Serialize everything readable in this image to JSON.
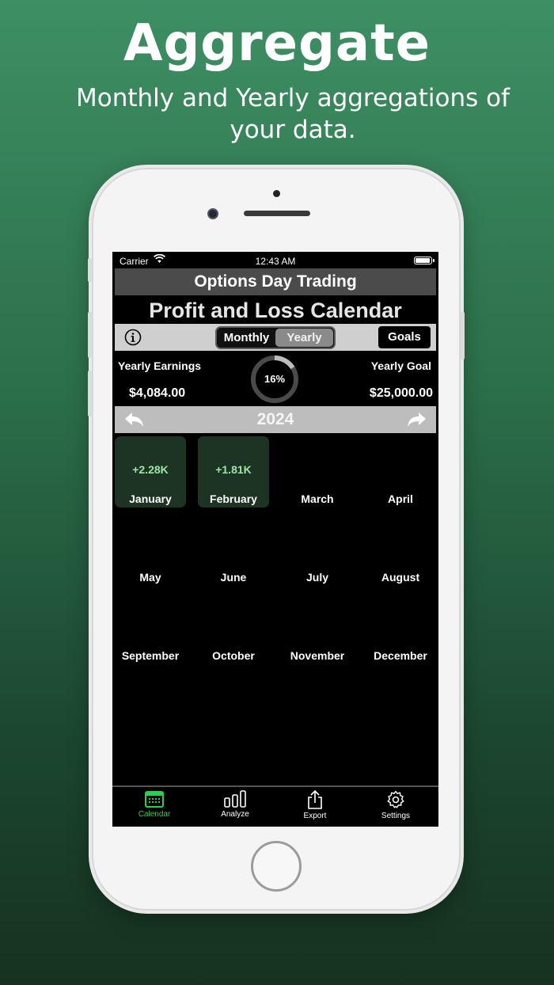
{
  "hero": {
    "title": "Aggregate",
    "subtitle": "Monthly and Yearly aggregations of your data."
  },
  "status_bar": {
    "carrier": "Carrier",
    "time": "12:43 AM"
  },
  "app": {
    "header_title": "Options Day Trading",
    "calendar_title": "Profit and Loss Calendar",
    "toolbar": {
      "segments": [
        "Monthly",
        "Yearly"
      ],
      "selected_segment": "Yearly",
      "goals_label": "Goals"
    },
    "stats": {
      "earnings_label": "Yearly Earnings",
      "earnings_value": "$4,084.00",
      "goal_label": "Yearly Goal",
      "goal_value": "$25,000.00",
      "progress_label": "16%",
      "progress_fraction": 0.16
    },
    "year": "2024",
    "months": [
      {
        "name": "January",
        "value": "+2.28K"
      },
      {
        "name": "February",
        "value": "+1.81K"
      },
      {
        "name": "March",
        "value": ""
      },
      {
        "name": "April",
        "value": ""
      },
      {
        "name": "May",
        "value": ""
      },
      {
        "name": "June",
        "value": ""
      },
      {
        "name": "July",
        "value": ""
      },
      {
        "name": "August",
        "value": ""
      },
      {
        "name": "September",
        "value": ""
      },
      {
        "name": "October",
        "value": ""
      },
      {
        "name": "November",
        "value": ""
      },
      {
        "name": "December",
        "value": ""
      }
    ],
    "tabs": [
      {
        "label": "Calendar",
        "icon": "calendar-icon",
        "active": true
      },
      {
        "label": "Analyze",
        "icon": "bar-chart-icon",
        "active": false
      },
      {
        "label": "Export",
        "icon": "share-icon",
        "active": false
      },
      {
        "label": "Settings",
        "icon": "gear-icon",
        "active": false
      }
    ],
    "colors": {
      "positive": "#9be6a4",
      "active_tab": "#25d24a",
      "month_highlight": "#1d3324"
    }
  }
}
